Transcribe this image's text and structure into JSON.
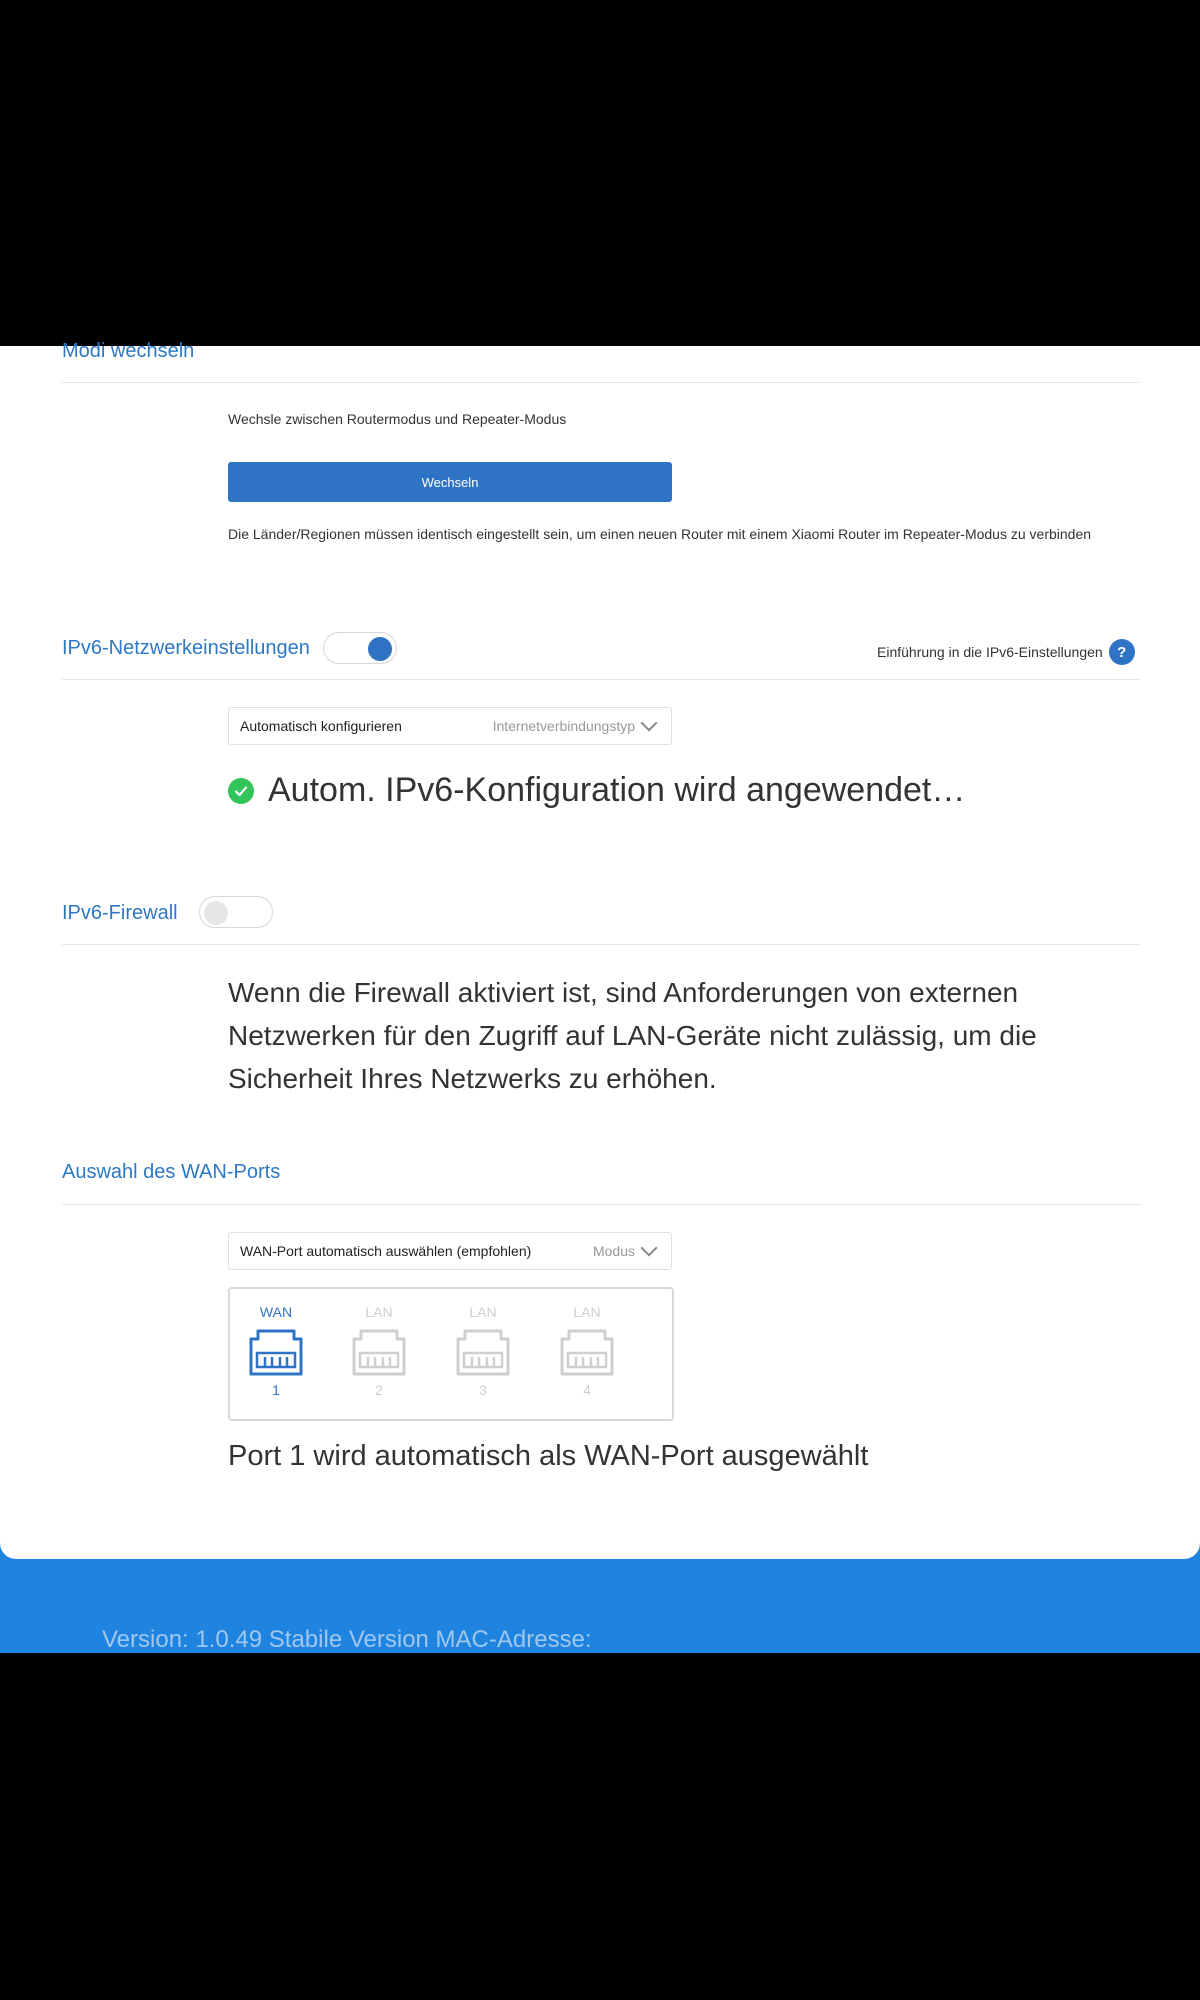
{
  "modes": {
    "title": "Modi wechseln",
    "description": "Wechsle zwischen Routermodus und Repeater-Modus",
    "button_label": "Wechseln",
    "note": "Die Länder/Regionen müssen identisch eingestellt sein, um einen neuen Router mit einem Xiaomi Router im Repeater-Modus zu verbinden"
  },
  "ipv6": {
    "title": "IPv6-Netzwerkeinstellungen",
    "toggle_on": true,
    "help_label": "Einführung in die IPv6-Einstellungen",
    "help_icon": "help-icon",
    "select_value": "Automatisch konfigurieren",
    "select_label": "Internetverbindungstyp",
    "status_text": "Autom. IPv6-Konfiguration wird angewendet…"
  },
  "firewall": {
    "title": "IPv6-Firewall",
    "toggle_on": false,
    "description": "Wenn die Firewall aktiviert ist, sind Anforderungen von externen Netzwerken für den Zugriff auf LAN-Geräte nicht zulässig, um die Sicherheit Ihres Netzwerks zu erhöhen."
  },
  "wan": {
    "title": "Auswahl des WAN-Ports",
    "select_value": "WAN-Port automatisch auswählen (empfohlen)",
    "select_label": "Modus",
    "ports": [
      {
        "label": "WAN",
        "number": "1",
        "active": true
      },
      {
        "label": "LAN",
        "number": "2",
        "active": false
      },
      {
        "label": "LAN",
        "number": "3",
        "active": false
      },
      {
        "label": "LAN",
        "number": "4",
        "active": false
      }
    ],
    "result_text": "Port 1 wird automatisch als WAN-Port ausgewählt"
  },
  "footer": {
    "version_text": "Version: 1.0.49 Stabile Version  MAC-Adresse:"
  },
  "colors": {
    "accent": "#2f73c5",
    "footer": "#1f84e0",
    "success": "#32c55c"
  }
}
